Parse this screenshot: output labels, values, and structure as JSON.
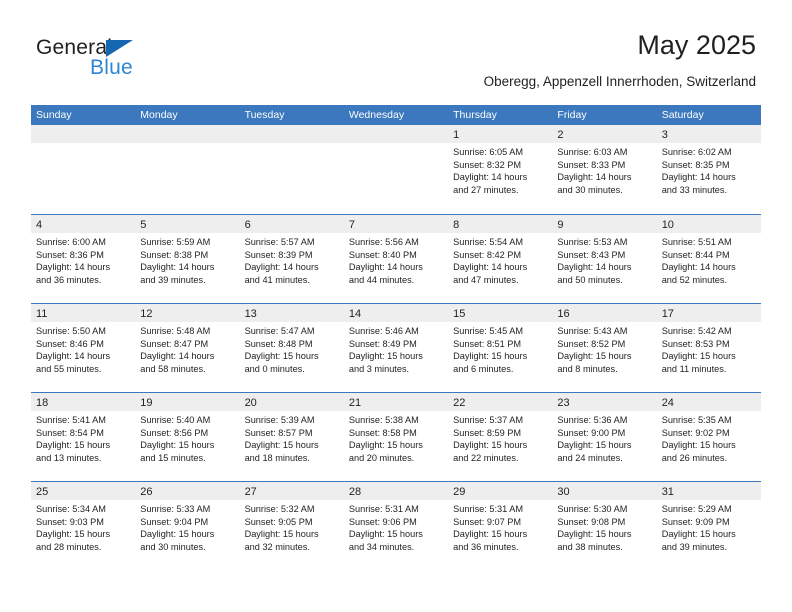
{
  "brand": {
    "name_part1": "General",
    "name_part2": "Blue",
    "triangle_icon": "triangle-icon",
    "accent_color": "#2f86d4",
    "triangle_color": "#1567b2"
  },
  "header": {
    "title": "May 2025",
    "subtitle": "Oberegg, Appenzell Innerrhoden, Switzerland",
    "header_bar_color": "#3b78be",
    "day_band_color": "#eeeeee"
  },
  "weekdays": [
    "Sunday",
    "Monday",
    "Tuesday",
    "Wednesday",
    "Thursday",
    "Friday",
    "Saturday"
  ],
  "weeks": [
    [
      {
        "day": "",
        "empty": true,
        "sunrise": "",
        "sunset": "",
        "daylight_line1": "",
        "daylight_line2": ""
      },
      {
        "day": "",
        "empty": true,
        "sunrise": "",
        "sunset": "",
        "daylight_line1": "",
        "daylight_line2": ""
      },
      {
        "day": "",
        "empty": true,
        "sunrise": "",
        "sunset": "",
        "daylight_line1": "",
        "daylight_line2": ""
      },
      {
        "day": "",
        "empty": true,
        "sunrise": "",
        "sunset": "",
        "daylight_line1": "",
        "daylight_line2": ""
      },
      {
        "day": "1",
        "empty": false,
        "sunrise": "Sunrise: 6:05 AM",
        "sunset": "Sunset: 8:32 PM",
        "daylight_line1": "Daylight: 14 hours",
        "daylight_line2": "and 27 minutes."
      },
      {
        "day": "2",
        "empty": false,
        "sunrise": "Sunrise: 6:03 AM",
        "sunset": "Sunset: 8:33 PM",
        "daylight_line1": "Daylight: 14 hours",
        "daylight_line2": "and 30 minutes."
      },
      {
        "day": "3",
        "empty": false,
        "sunrise": "Sunrise: 6:02 AM",
        "sunset": "Sunset: 8:35 PM",
        "daylight_line1": "Daylight: 14 hours",
        "daylight_line2": "and 33 minutes."
      }
    ],
    [
      {
        "day": "4",
        "empty": false,
        "sunrise": "Sunrise: 6:00 AM",
        "sunset": "Sunset: 8:36 PM",
        "daylight_line1": "Daylight: 14 hours",
        "daylight_line2": "and 36 minutes."
      },
      {
        "day": "5",
        "empty": false,
        "sunrise": "Sunrise: 5:59 AM",
        "sunset": "Sunset: 8:38 PM",
        "daylight_line1": "Daylight: 14 hours",
        "daylight_line2": "and 39 minutes."
      },
      {
        "day": "6",
        "empty": false,
        "sunrise": "Sunrise: 5:57 AM",
        "sunset": "Sunset: 8:39 PM",
        "daylight_line1": "Daylight: 14 hours",
        "daylight_line2": "and 41 minutes."
      },
      {
        "day": "7",
        "empty": false,
        "sunrise": "Sunrise: 5:56 AM",
        "sunset": "Sunset: 8:40 PM",
        "daylight_line1": "Daylight: 14 hours",
        "daylight_line2": "and 44 minutes."
      },
      {
        "day": "8",
        "empty": false,
        "sunrise": "Sunrise: 5:54 AM",
        "sunset": "Sunset: 8:42 PM",
        "daylight_line1": "Daylight: 14 hours",
        "daylight_line2": "and 47 minutes."
      },
      {
        "day": "9",
        "empty": false,
        "sunrise": "Sunrise: 5:53 AM",
        "sunset": "Sunset: 8:43 PM",
        "daylight_line1": "Daylight: 14 hours",
        "daylight_line2": "and 50 minutes."
      },
      {
        "day": "10",
        "empty": false,
        "sunrise": "Sunrise: 5:51 AM",
        "sunset": "Sunset: 8:44 PM",
        "daylight_line1": "Daylight: 14 hours",
        "daylight_line2": "and 52 minutes."
      }
    ],
    [
      {
        "day": "11",
        "empty": false,
        "sunrise": "Sunrise: 5:50 AM",
        "sunset": "Sunset: 8:46 PM",
        "daylight_line1": "Daylight: 14 hours",
        "daylight_line2": "and 55 minutes."
      },
      {
        "day": "12",
        "empty": false,
        "sunrise": "Sunrise: 5:48 AM",
        "sunset": "Sunset: 8:47 PM",
        "daylight_line1": "Daylight: 14 hours",
        "daylight_line2": "and 58 minutes."
      },
      {
        "day": "13",
        "empty": false,
        "sunrise": "Sunrise: 5:47 AM",
        "sunset": "Sunset: 8:48 PM",
        "daylight_line1": "Daylight: 15 hours",
        "daylight_line2": "and 0 minutes."
      },
      {
        "day": "14",
        "empty": false,
        "sunrise": "Sunrise: 5:46 AM",
        "sunset": "Sunset: 8:49 PM",
        "daylight_line1": "Daylight: 15 hours",
        "daylight_line2": "and 3 minutes."
      },
      {
        "day": "15",
        "empty": false,
        "sunrise": "Sunrise: 5:45 AM",
        "sunset": "Sunset: 8:51 PM",
        "daylight_line1": "Daylight: 15 hours",
        "daylight_line2": "and 6 minutes."
      },
      {
        "day": "16",
        "empty": false,
        "sunrise": "Sunrise: 5:43 AM",
        "sunset": "Sunset: 8:52 PM",
        "daylight_line1": "Daylight: 15 hours",
        "daylight_line2": "and 8 minutes."
      },
      {
        "day": "17",
        "empty": false,
        "sunrise": "Sunrise: 5:42 AM",
        "sunset": "Sunset: 8:53 PM",
        "daylight_line1": "Daylight: 15 hours",
        "daylight_line2": "and 11 minutes."
      }
    ],
    [
      {
        "day": "18",
        "empty": false,
        "sunrise": "Sunrise: 5:41 AM",
        "sunset": "Sunset: 8:54 PM",
        "daylight_line1": "Daylight: 15 hours",
        "daylight_line2": "and 13 minutes."
      },
      {
        "day": "19",
        "empty": false,
        "sunrise": "Sunrise: 5:40 AM",
        "sunset": "Sunset: 8:56 PM",
        "daylight_line1": "Daylight: 15 hours",
        "daylight_line2": "and 15 minutes."
      },
      {
        "day": "20",
        "empty": false,
        "sunrise": "Sunrise: 5:39 AM",
        "sunset": "Sunset: 8:57 PM",
        "daylight_line1": "Daylight: 15 hours",
        "daylight_line2": "and 18 minutes."
      },
      {
        "day": "21",
        "empty": false,
        "sunrise": "Sunrise: 5:38 AM",
        "sunset": "Sunset: 8:58 PM",
        "daylight_line1": "Daylight: 15 hours",
        "daylight_line2": "and 20 minutes."
      },
      {
        "day": "22",
        "empty": false,
        "sunrise": "Sunrise: 5:37 AM",
        "sunset": "Sunset: 8:59 PM",
        "daylight_line1": "Daylight: 15 hours",
        "daylight_line2": "and 22 minutes."
      },
      {
        "day": "23",
        "empty": false,
        "sunrise": "Sunrise: 5:36 AM",
        "sunset": "Sunset: 9:00 PM",
        "daylight_line1": "Daylight: 15 hours",
        "daylight_line2": "and 24 minutes."
      },
      {
        "day": "24",
        "empty": false,
        "sunrise": "Sunrise: 5:35 AM",
        "sunset": "Sunset: 9:02 PM",
        "daylight_line1": "Daylight: 15 hours",
        "daylight_line2": "and 26 minutes."
      }
    ],
    [
      {
        "day": "25",
        "empty": false,
        "sunrise": "Sunrise: 5:34 AM",
        "sunset": "Sunset: 9:03 PM",
        "daylight_line1": "Daylight: 15 hours",
        "daylight_line2": "and 28 minutes."
      },
      {
        "day": "26",
        "empty": false,
        "sunrise": "Sunrise: 5:33 AM",
        "sunset": "Sunset: 9:04 PM",
        "daylight_line1": "Daylight: 15 hours",
        "daylight_line2": "and 30 minutes."
      },
      {
        "day": "27",
        "empty": false,
        "sunrise": "Sunrise: 5:32 AM",
        "sunset": "Sunset: 9:05 PM",
        "daylight_line1": "Daylight: 15 hours",
        "daylight_line2": "and 32 minutes."
      },
      {
        "day": "28",
        "empty": false,
        "sunrise": "Sunrise: 5:31 AM",
        "sunset": "Sunset: 9:06 PM",
        "daylight_line1": "Daylight: 15 hours",
        "daylight_line2": "and 34 minutes."
      },
      {
        "day": "29",
        "empty": false,
        "sunrise": "Sunrise: 5:31 AM",
        "sunset": "Sunset: 9:07 PM",
        "daylight_line1": "Daylight: 15 hours",
        "daylight_line2": "and 36 minutes."
      },
      {
        "day": "30",
        "empty": false,
        "sunrise": "Sunrise: 5:30 AM",
        "sunset": "Sunset: 9:08 PM",
        "daylight_line1": "Daylight: 15 hours",
        "daylight_line2": "and 38 minutes."
      },
      {
        "day": "31",
        "empty": false,
        "sunrise": "Sunrise: 5:29 AM",
        "sunset": "Sunset: 9:09 PM",
        "daylight_line1": "Daylight: 15 hours",
        "daylight_line2": "and 39 minutes."
      }
    ]
  ]
}
